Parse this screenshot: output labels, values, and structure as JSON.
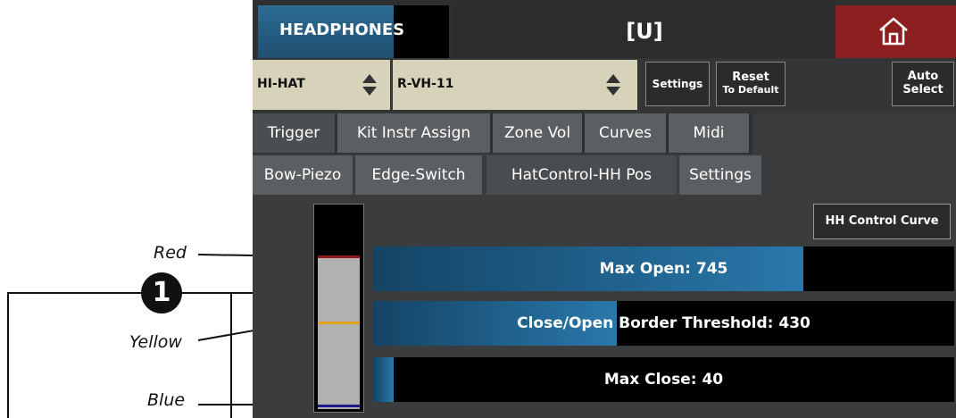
{
  "annotations": {
    "red_label": "Red",
    "yellow_label": "Yellow",
    "blue_label": "Blue",
    "badge_number": "1"
  },
  "header": {
    "section_label": "HEADPHONES",
    "title": "[U]"
  },
  "selectors": {
    "pad": "HI-HAT",
    "instrument": "R-VH-11",
    "settings_label": "Settings",
    "reset_label_line1": "Reset",
    "reset_label_line2": "To Default",
    "auto_select_line1": "Auto",
    "auto_select_line2": "Select"
  },
  "tabs": [
    {
      "label": "Trigger",
      "active": true
    },
    {
      "label": "Kit Instr Assign",
      "active": false
    },
    {
      "label": "Zone Vol",
      "active": false
    },
    {
      "label": "Curves",
      "active": false
    },
    {
      "label": "Midi",
      "active": false
    }
  ],
  "subtabs": [
    {
      "label": "Bow-Piezo",
      "active": false
    },
    {
      "label": "Edge-Switch",
      "active": false
    },
    {
      "label": "HatControl-HH Pos",
      "active": true
    },
    {
      "label": "Settings",
      "active": false
    }
  ],
  "hh_control_curve_label": "HH Control Curve",
  "bars": [
    {
      "label": "Max Open: 745",
      "fraction": 0.74
    },
    {
      "label": "Close/Open Border Threshold: 430",
      "fraction": 0.42
    },
    {
      "label": "Max Close: 40",
      "fraction": 0.035
    }
  ],
  "meter_marks": {
    "red": "#8b1a1a",
    "yellow": "#e1a21f",
    "blue": "#1c1c8f"
  },
  "colors": {
    "accent": "#2a78ab",
    "home": "#8c1f1f"
  }
}
